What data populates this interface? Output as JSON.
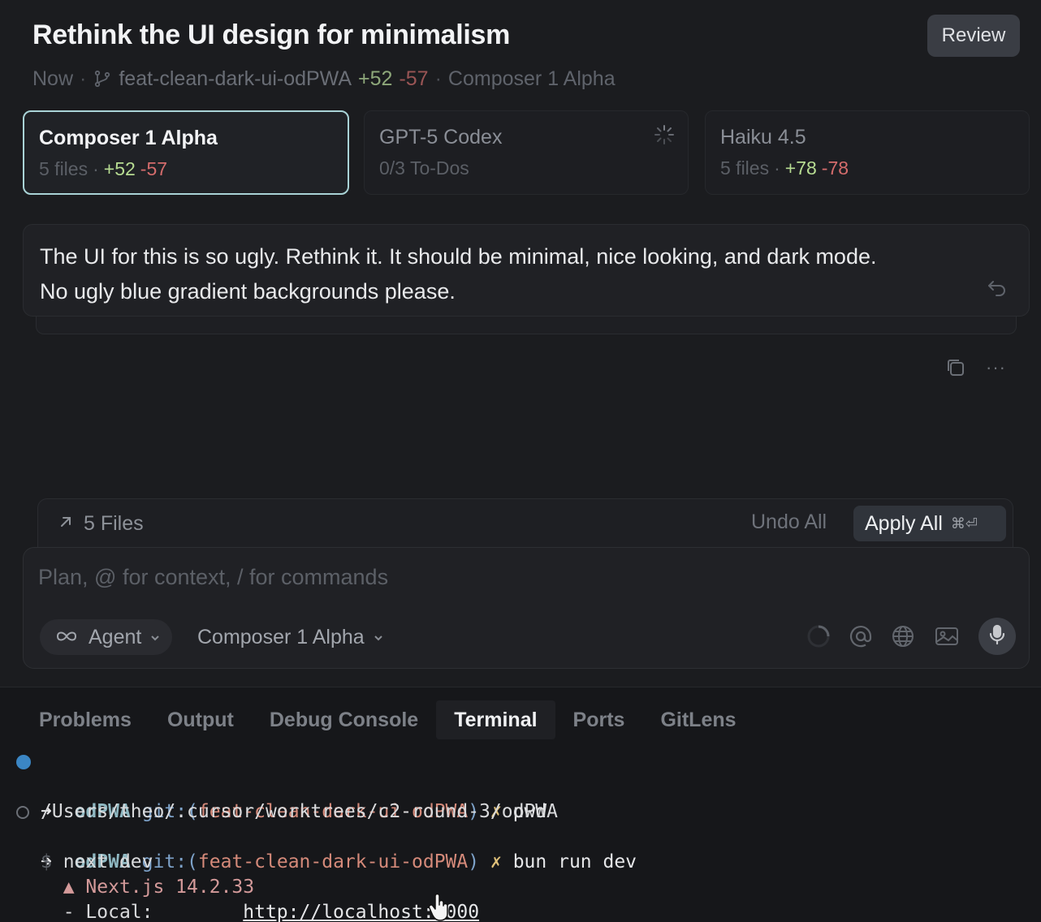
{
  "header": {
    "title": "Rethink the UI design for minimalism",
    "review_label": "Review",
    "meta": {
      "time": "Now",
      "branch": "feat-clean-dark-ui-odPWA",
      "additions": "+52",
      "deletions": "-57",
      "model": "Composer 1 Alpha"
    }
  },
  "models": [
    {
      "name": "Composer 1 Alpha",
      "files": "5 files",
      "additions": "+52",
      "deletions": "-57",
      "active": true
    },
    {
      "name": "GPT-5 Codex",
      "todos": "0/3 To-Dos",
      "loading": true
    },
    {
      "name": "Haiku 4.5",
      "files": "5 files",
      "additions": "+78",
      "deletions": "-78"
    }
  ],
  "message": {
    "line1": "The UI for this is so ugly. Rethink it. It should be minimal, nice looking, and dark mode.",
    "line2": "No ugly blue gradient backgrounds please."
  },
  "files_bar": {
    "label": "5 Files",
    "undo_all": "Undo All",
    "apply_all": "Apply All",
    "apply_shortcut": "⌘⏎"
  },
  "composer": {
    "placeholder": "Plan, @ for context, / for commands",
    "mode": "Agent",
    "model": "Composer 1 Alpha"
  },
  "panel": {
    "tabs": [
      "Problems",
      "Output",
      "Debug Console",
      "Terminal",
      "Ports",
      "GitLens"
    ],
    "active_tab": "Terminal"
  },
  "terminal": {
    "prompt_arrow": "➜",
    "dir": "odPWA",
    "git_prefix": "git:(",
    "branch": "feat-clean-dark-ui-odPWA",
    "git_suffix": ")",
    "dirty_mark": "✗",
    "cmd1": "pwd",
    "out1": "/Users/theo/.cursor/worktrees/c2-round-3/odPWA",
    "cmd2": "bun run dev",
    "line_next_prefix": "$",
    "line_next_cmd": "next dev",
    "next_version": "▲ Next.js 14.2.33",
    "local_label": "- Local:",
    "local_url": "http://localhost:3000"
  },
  "colors": {
    "accent_border": "#a9d3d6",
    "additions": "#b7dc92",
    "deletions": "#d46c6c",
    "branch": "#d58a7a",
    "terminal_dot": "#3b86c4"
  }
}
